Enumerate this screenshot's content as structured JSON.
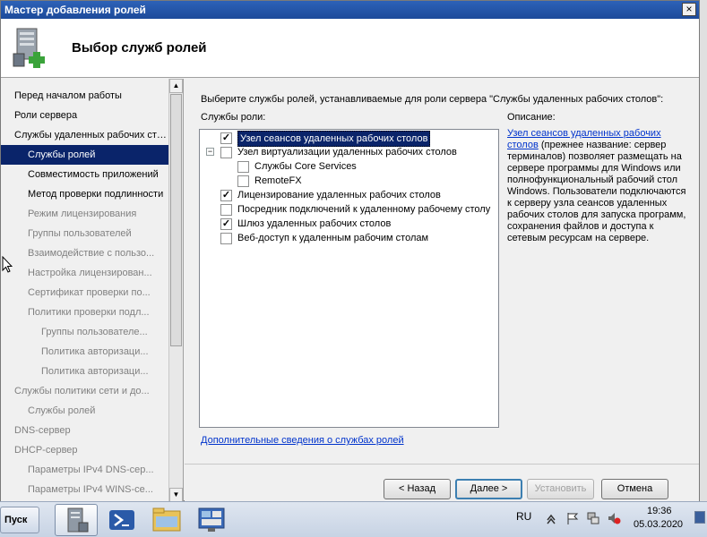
{
  "window": {
    "title": "Мастер добавления ролей",
    "close_glyph": "×"
  },
  "header": {
    "title": "Выбор служб ролей"
  },
  "nav": {
    "items": [
      {
        "label": "Перед началом работы",
        "level": 0,
        "state": "normal"
      },
      {
        "label": "Роли сервера",
        "level": 0,
        "state": "normal"
      },
      {
        "label": "Службы удаленных рабочих сто...",
        "level": 0,
        "state": "normal"
      },
      {
        "label": "Службы ролей",
        "level": 1,
        "state": "active"
      },
      {
        "label": "Совместимость приложений",
        "level": 1,
        "state": "normal"
      },
      {
        "label": "Метод проверки подлинности",
        "level": 1,
        "state": "normal"
      },
      {
        "label": "Режим лицензирования",
        "level": 1,
        "state": "disabled"
      },
      {
        "label": "Группы пользователей",
        "level": 1,
        "state": "disabled"
      },
      {
        "label": "Взаимодействие с пользо...",
        "level": 1,
        "state": "disabled"
      },
      {
        "label": "Настройка лицензирован...",
        "level": 1,
        "state": "disabled"
      },
      {
        "label": "Сертификат проверки по...",
        "level": 1,
        "state": "disabled"
      },
      {
        "label": "Политики проверки подл...",
        "level": 1,
        "state": "disabled"
      },
      {
        "label": "Группы пользователе...",
        "level": 2,
        "state": "disabled"
      },
      {
        "label": "Политика авторизаци...",
        "level": 2,
        "state": "disabled"
      },
      {
        "label": "Политика авторизаци...",
        "level": 2,
        "state": "disabled"
      },
      {
        "label": "Службы политики сети и до...",
        "level": 0,
        "state": "disabled"
      },
      {
        "label": "Службы ролей",
        "level": 1,
        "state": "disabled"
      },
      {
        "label": "DNS-сервер",
        "level": 0,
        "state": "disabled"
      },
      {
        "label": "DHCP-сервер",
        "level": 0,
        "state": "disabled"
      },
      {
        "label": "Параметры IPv4 DNS-сер...",
        "level": 1,
        "state": "disabled"
      },
      {
        "label": "Параметры IPv4 WINS-се...",
        "level": 1,
        "state": "disabled"
      }
    ]
  },
  "content": {
    "instruction": "Выберите службы ролей, устанавливаемые для роли сервера \"Службы удаленных рабочих столов\":",
    "roles_label": "Службы роли:",
    "description_label": "Описание:",
    "services": [
      {
        "label": "Узел сеансов удаленных рабочих столов",
        "checked": true,
        "indent": 0,
        "selected": true
      },
      {
        "label": "Узел виртуализации удаленных рабочих столов",
        "checked": false,
        "indent": 0,
        "expander": "−"
      },
      {
        "label": "Службы Core Services",
        "checked": false,
        "indent": 1
      },
      {
        "label": "RemoteFX",
        "checked": false,
        "indent": 1
      },
      {
        "label": "Лицензирование удаленных рабочих столов",
        "checked": true,
        "indent": 0
      },
      {
        "label": "Посредник подключений к удаленному рабочему столу",
        "checked": false,
        "indent": 0
      },
      {
        "label": "Шлюз удаленных рабочих столов",
        "checked": true,
        "indent": 0
      },
      {
        "label": "Веб-доступ к удаленным рабочим столам",
        "checked": false,
        "indent": 0
      }
    ],
    "description_link": "Узел сеансов удаленных рабочих столов",
    "description_text": " (прежнее название: сервер терминалов) позволяет размещать на сервере программы для Windows или полнофункциональный рабочий стол Windows. Пользователи подключаются к серверу узла сеансов удаленных рабочих столов для запуска программ, сохранения файлов и доступа к сетевым ресурсам на сервере.",
    "more_info_link": "Дополнительные сведения о службах ролей"
  },
  "buttons": {
    "back": "< Назад",
    "next": "Далее >",
    "install": "Установить",
    "cancel": "Отмена"
  },
  "taskbar": {
    "start": "Пуск",
    "apps": [
      "server-manager-icon",
      "powershell-icon",
      "explorer-icon",
      "remote-desktop-icon"
    ],
    "language": "RU",
    "time": "19:36",
    "date": "05.03.2020"
  },
  "colors": {
    "selection": "#0a246a",
    "link": "#0033cc",
    "titlebar": "#1c4a9a"
  }
}
